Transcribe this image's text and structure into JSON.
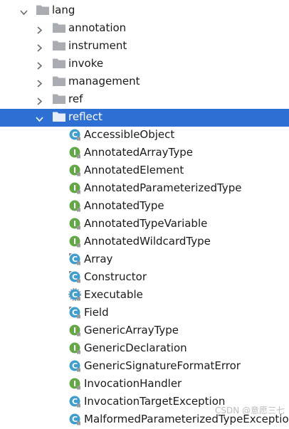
{
  "tree": {
    "root": {
      "label": "lang",
      "expanded": true,
      "icon": "folder-icon"
    },
    "packages": [
      {
        "label": "annotation",
        "expanded": false,
        "icon": "folder-icon"
      },
      {
        "label": "instrument",
        "expanded": false,
        "icon": "folder-icon"
      },
      {
        "label": "invoke",
        "expanded": false,
        "icon": "folder-icon"
      },
      {
        "label": "management",
        "expanded": false,
        "icon": "folder-icon"
      },
      {
        "label": "ref",
        "expanded": false,
        "icon": "folder-icon"
      },
      {
        "label": "reflect",
        "expanded": true,
        "selected": true,
        "icon": "folder-icon"
      }
    ],
    "reflect_children": [
      {
        "label": "AccessibleObject",
        "kind": "class"
      },
      {
        "label": "AnnotatedArrayType",
        "kind": "interface"
      },
      {
        "label": "AnnotatedElement",
        "kind": "interface"
      },
      {
        "label": "AnnotatedParameterizedType",
        "kind": "interface"
      },
      {
        "label": "AnnotatedType",
        "kind": "interface"
      },
      {
        "label": "AnnotatedTypeVariable",
        "kind": "interface"
      },
      {
        "label": "AnnotatedWildcardType",
        "kind": "interface"
      },
      {
        "label": "Array",
        "kind": "final-class"
      },
      {
        "label": "Constructor",
        "kind": "final-class"
      },
      {
        "label": "Executable",
        "kind": "abstract-class"
      },
      {
        "label": "Field",
        "kind": "final-class"
      },
      {
        "label": "GenericArrayType",
        "kind": "interface"
      },
      {
        "label": "GenericDeclaration",
        "kind": "interface"
      },
      {
        "label": "GenericSignatureFormatError",
        "kind": "class"
      },
      {
        "label": "InvocationHandler",
        "kind": "interface"
      },
      {
        "label": "InvocationTargetException",
        "kind": "class"
      },
      {
        "label": "MalformedParameterizedTypeException",
        "kind": "class"
      }
    ]
  },
  "watermark": "CSDN @意愿三七",
  "colors": {
    "selection": "#2e6fd4",
    "folder": "#a9acb0",
    "class_icon": "#3e9fcf",
    "interface_icon": "#62a845"
  }
}
